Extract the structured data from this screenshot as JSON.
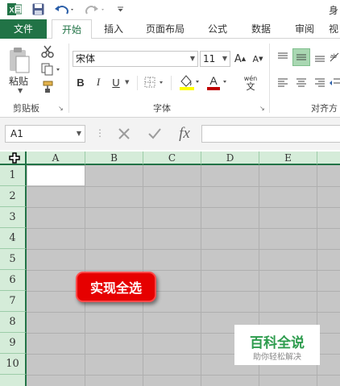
{
  "title_bar": {
    "right_partial_text": "身"
  },
  "tabs": [
    {
      "label": "文件",
      "kind": "file"
    },
    {
      "label": "开始",
      "kind": "active"
    },
    {
      "label": "插入"
    },
    {
      "label": "页面布局"
    },
    {
      "label": "公式"
    },
    {
      "label": "数据"
    },
    {
      "label": "审阅"
    },
    {
      "label": "视"
    }
  ],
  "ribbon": {
    "clipboard": {
      "paste_label": "粘贴",
      "group_label": "剪贴板"
    },
    "font": {
      "font_name": "宋体",
      "font_size": "11",
      "bold": "B",
      "italic": "I",
      "underline": "U",
      "grow": "A",
      "shrink": "A",
      "font_color_letter": "A",
      "phonetic_top": "wén",
      "phonetic_bottom": "文",
      "group_label": "字体"
    },
    "alignment": {
      "group_label": "对齐方"
    }
  },
  "formula_bar": {
    "name_box_value": "A1",
    "fx_label": "fx"
  },
  "grid": {
    "columns": [
      "A",
      "B",
      "C",
      "D",
      "E"
    ],
    "rows": [
      "1",
      "2",
      "3",
      "4",
      "5",
      "6",
      "7",
      "8",
      "9",
      "10"
    ]
  },
  "callout": {
    "text": "实现全选"
  },
  "watermark": {
    "title": "百科全说",
    "subtitle": "助你轻松解决"
  },
  "colors": {
    "excel_green": "#217346",
    "header_fill": "#d5ecd9",
    "selection_fill": "#c6c6c6",
    "callout_red": "#e60000"
  }
}
